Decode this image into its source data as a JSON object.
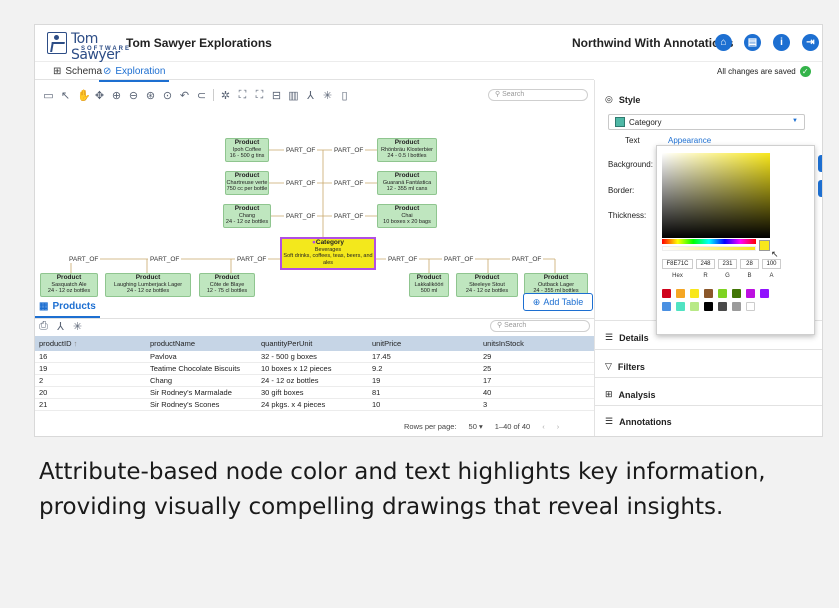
{
  "header": {
    "logo_text": "Tom Sawyer",
    "logo_sub": "SOFTWARE",
    "app_title": "Tom Sawyer Explorations",
    "project_title": "Northwind With Annotations"
  },
  "tabs": [
    {
      "label": "Schema"
    },
    {
      "label": "Exploration"
    }
  ],
  "save_status": "All changes are saved",
  "graph": {
    "search_placeholder": "Search",
    "edge_label": "PART_OF",
    "category": {
      "title": "Category",
      "name": "Beverages",
      "desc": "Soft drinks, coffees, teas, beers, and ales"
    },
    "products_top": [
      {
        "title": "Product",
        "name": "Ipoh Coffee",
        "qty": "16 - 500 g tins"
      },
      {
        "title": "Product",
        "name": "Chartreuse verte",
        "qty": "750 cc per bottle"
      },
      {
        "title": "Product",
        "name": "Chang",
        "qty": "24 - 12 oz bottles"
      },
      {
        "title": "Product",
        "name": "Rhönbräu Klosterbier",
        "qty": "24 - 0.5 l bottles"
      },
      {
        "title": "Product",
        "name": "Guaraná Fantástica",
        "qty": "12 - 355 ml cans"
      },
      {
        "title": "Product",
        "name": "Chai",
        "qty": "10 boxes x 20 bags"
      }
    ],
    "products_bottom": [
      {
        "title": "Product",
        "name": "Sasquatch Ale",
        "qty": "24 - 12 oz bottles"
      },
      {
        "title": "Product",
        "name": "Laughing Lumberjack Lager",
        "qty": "24 - 12 oz bottles"
      },
      {
        "title": "Product",
        "name": "Côte de Blaye",
        "qty": "12 - 75 cl bottles"
      },
      {
        "title": "Product",
        "name": "Lakkalikööri",
        "qty": "500 ml"
      },
      {
        "title": "Product",
        "name": "Steeleye Stout",
        "qty": "24 - 12 oz bottles"
      },
      {
        "title": "Product",
        "name": "Outback Lager",
        "qty": "24 - 355 ml bottles"
      }
    ]
  },
  "products": {
    "tab_label": "Products",
    "add_table_label": "Add Table",
    "search_placeholder": "Search",
    "columns": [
      "productID",
      "productName",
      "quantityPerUnit",
      "unitPrice",
      "unitsInStock"
    ],
    "rows": [
      [
        "16",
        "Pavlova",
        "32 - 500 g boxes",
        "17.45",
        "29"
      ],
      [
        "19",
        "Teatime Chocolate Biscuits",
        "10 boxes x 12 pieces",
        "9.2",
        "25"
      ],
      [
        "2",
        "Chang",
        "24 - 12 oz bottles",
        "19",
        "17"
      ],
      [
        "20",
        "Sir Rodney's Marmalade",
        "30 gift boxes",
        "81",
        "40"
      ],
      [
        "21",
        "Sir Rodney's Scones",
        "24 pkgs. x 4 pieces",
        "10",
        "3"
      ]
    ],
    "rows_per_page_label": "Rows per page:",
    "rows_per_page": "50",
    "range": "1–40 of 40"
  },
  "style_panel": {
    "title": "Style",
    "selected": "Category",
    "subtabs": [
      "Text",
      "Appearance"
    ],
    "background_label": "Background:",
    "border_label": "Border:",
    "thickness_label": "Thickness:",
    "background_color": "#f8e71c",
    "accent_color": "#1d6fd1"
  },
  "color_picker": {
    "hex": "F8E71C",
    "r": "248",
    "g": "231",
    "b": "28",
    "a": "100",
    "labels": [
      "Hex",
      "R",
      "G",
      "B",
      "A"
    ],
    "presets": [
      "#d0021b",
      "#f5a623",
      "#f8e71c",
      "#8b572a",
      "#7ed321",
      "#417505",
      "#bd10e0",
      "#9013fe",
      "#4a90e2",
      "#50e3c2",
      "#b8e986",
      "#000000",
      "#4a4a4a",
      "#9b9b9b",
      "#ffffff"
    ]
  },
  "sections": [
    "Details",
    "Filters",
    "Analysis",
    "Annotations"
  ],
  "caption": "Attribute-based node color and text highlights key information, providing visually compelling drawings that reveal insights."
}
